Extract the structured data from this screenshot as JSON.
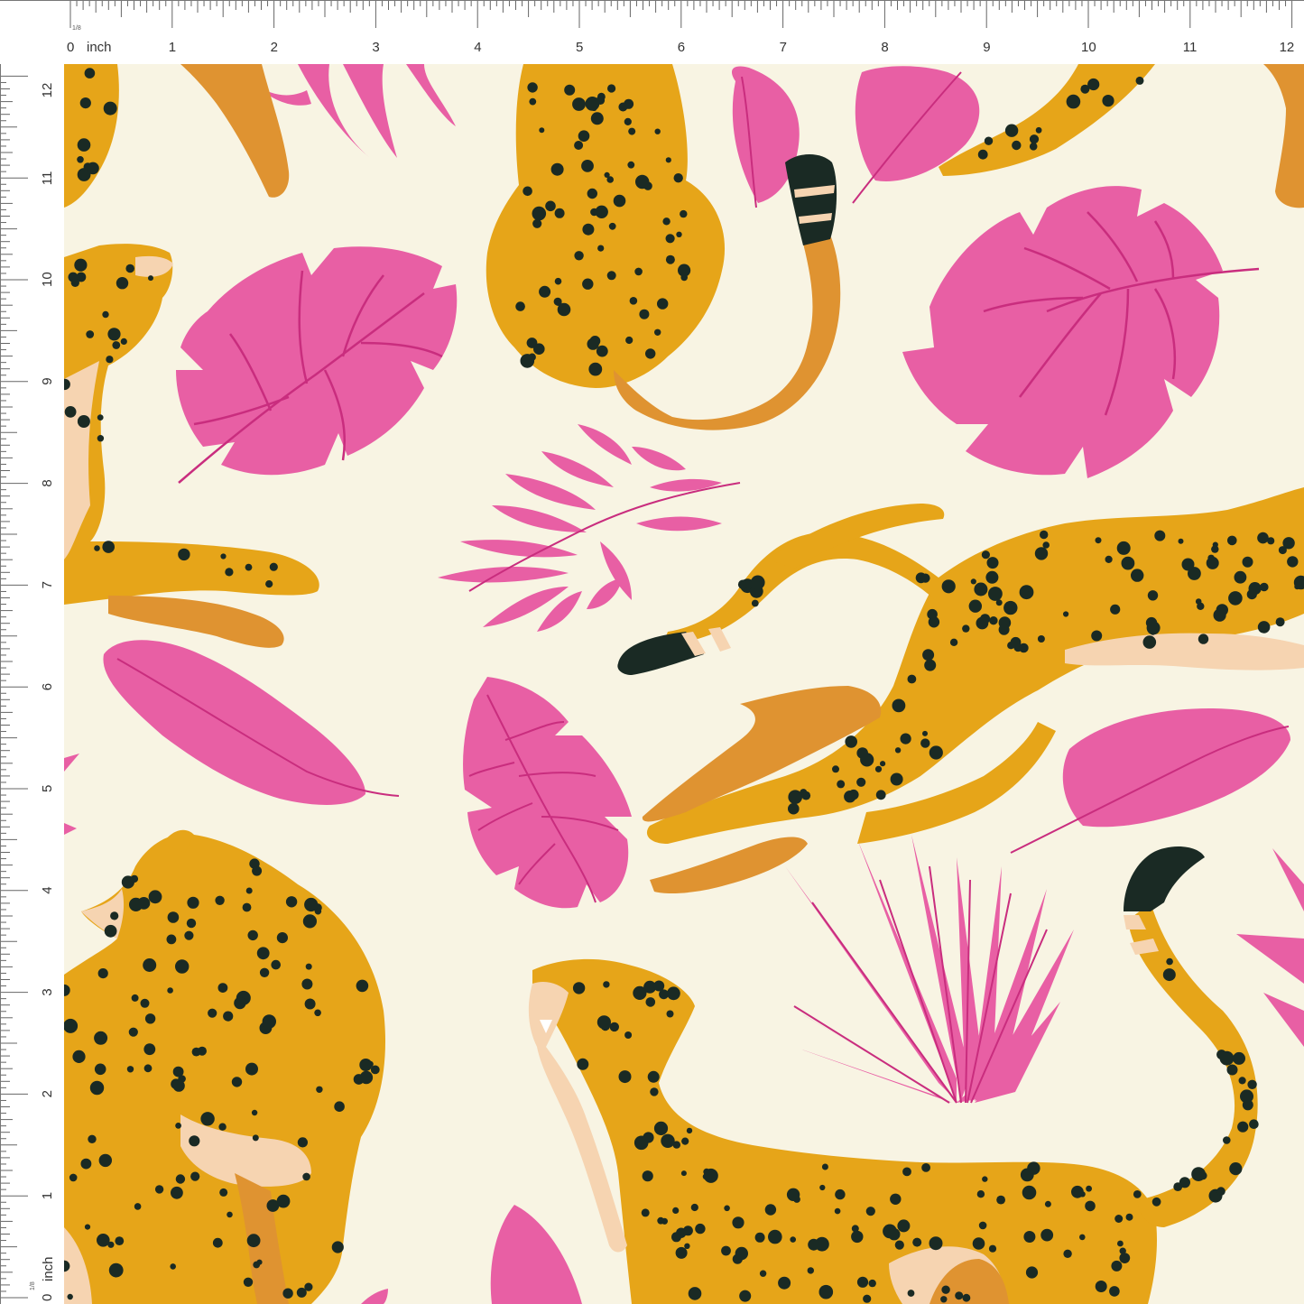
{
  "ruler": {
    "unit_label": "inch",
    "fraction_label": "1/8",
    "top_numbers": [
      "0",
      "1",
      "2",
      "3",
      "4",
      "5",
      "6",
      "7",
      "8",
      "9",
      "10",
      "11",
      "12"
    ],
    "left_numbers": [
      "12",
      "11",
      "10",
      "9",
      "8",
      "7",
      "6",
      "5",
      "4",
      "3",
      "2",
      "1",
      "0"
    ]
  },
  "print": {
    "motif": "cheetahs-and-tropical-leaves",
    "colors": {
      "background": "#F8F4E3",
      "cheetah_body": "#E6A519",
      "cheetah_shadow": "#DF9331",
      "cheetah_belly": "#F6D4B1",
      "spots": "#1A2A24",
      "leaf_pink": "#E85FA4",
      "leaf_vein": "#C92D7E"
    }
  }
}
